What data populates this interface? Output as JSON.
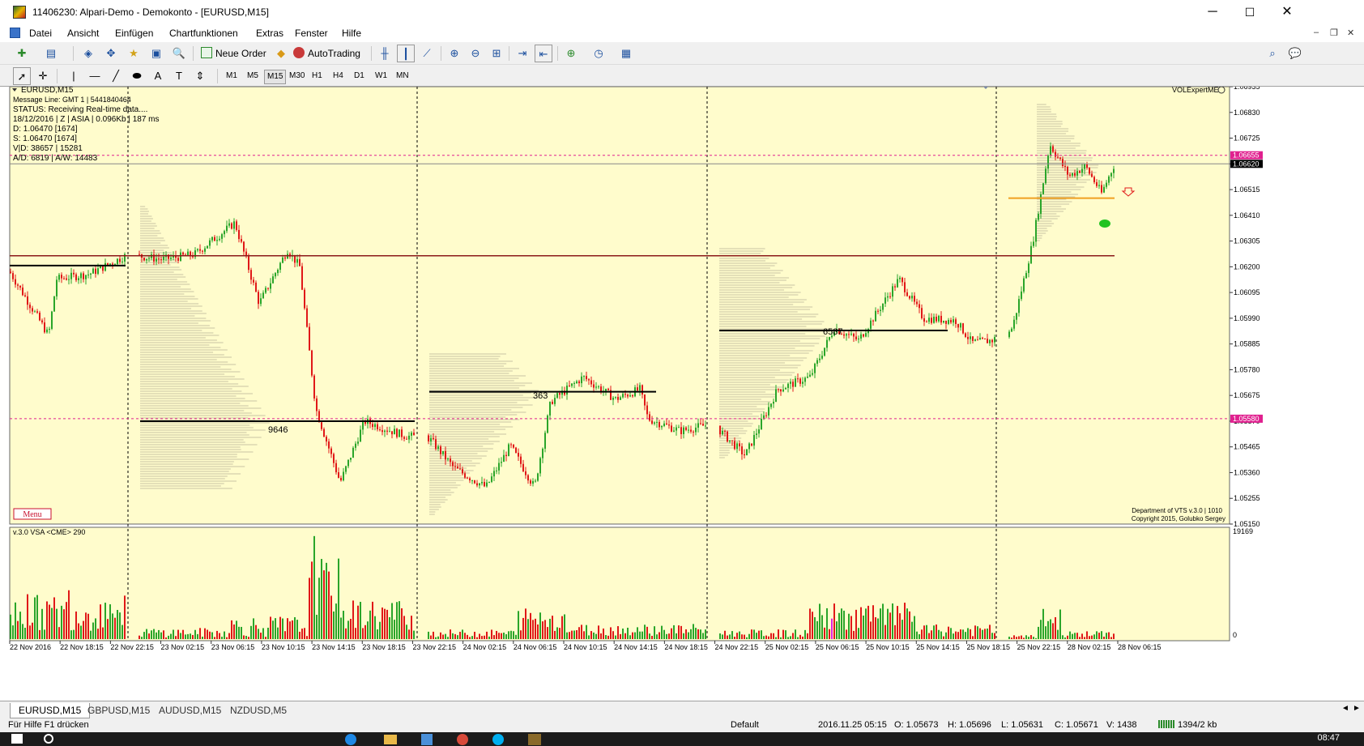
{
  "window": {
    "title": "11406230: Alpari-Demo - Demokonto - [EURUSD,M15]",
    "minimize": "─",
    "maximize": "☐",
    "close": "✕"
  },
  "menu": [
    "Datei",
    "Ansicht",
    "Einfügen",
    "Chartfunktionen",
    "Extras",
    "Fenster",
    "Hilfe"
  ],
  "toolbar": {
    "new_order": "Neue Order",
    "auto_trading": "AutoTrading"
  },
  "timeframes": [
    "M1",
    "M5",
    "M15",
    "M30",
    "H1",
    "H4",
    "D1",
    "W1",
    "MN"
  ],
  "active_timeframe": "M15",
  "chart": {
    "symbol_label": "EURUSD,M15",
    "info_lines": [
      "Message Line: GMT 1 | 5441840464",
      "STATUS:  Receiving Real-time data....",
      "18/12/2016 | Z | ASIA | 0.096Kb | 187 ms",
      "D: 1.06470  [1674]",
      "S: 1.06470  [1674]",
      "V|D: 38657 | 15281",
      "A/D: 6819 | A/W: 14483"
    ],
    "expert_label": "VOLExpertME",
    "menu_button": "Menu",
    "credits_1": "Department of VTS  v.3.0 | 1010",
    "credits_2": "Copyright 2015, Golubko Sergey",
    "volume_labels": [
      "9646",
      "363",
      "6587"
    ],
    "price_ticks": [
      "1.06935",
      "1.06830",
      "1.06725",
      "1.06620",
      "1.06515",
      "1.06410",
      "1.06305",
      "1.06200",
      "1.06095",
      "1.05990",
      "1.05885",
      "1.05780",
      "1.05675",
      "1.05570",
      "1.05465",
      "1.05360",
      "1.05255",
      "1.05150"
    ],
    "price_flags": [
      {
        "text": "1.06655",
        "color": "#e0208f"
      },
      {
        "text": "1.06620",
        "color": "#000000"
      },
      {
        "text": "1.05580",
        "color": "#e0208f"
      }
    ],
    "time_labels": [
      "22 Nov 2016",
      "22 Nov 18:15",
      "22 Nov 22:15",
      "23 Nov 02:15",
      "23 Nov 06:15",
      "23 Nov 10:15",
      "23 Nov 14:15",
      "23 Nov 18:15",
      "23 Nov 22:15",
      "24 Nov 02:15",
      "24 Nov 06:15",
      "24 Nov 10:15",
      "24 Nov 14:15",
      "24 Nov 18:15",
      "24 Nov 22:15",
      "25 Nov 02:15",
      "25 Nov 06:15",
      "25 Nov 10:15",
      "25 Nov 14:15",
      "25 Nov 18:15",
      "25 Nov 22:15",
      "28 Nov 02:15",
      "28 Nov 06:15"
    ],
    "sub_title": "v.3.0  VSA  <CME>  290",
    "sub_max": "19169",
    "sub_min": "0",
    "colors": {
      "background": "#fffccc",
      "bull": "#2aa52a",
      "bear": "#e01818",
      "level": "#8b1a1a",
      "orange": "#f0a020",
      "signal": "#22c322"
    }
  },
  "tabs": [
    "EURUSD,M15",
    "GBPUSD,M15",
    "AUDUSD,M15",
    "NZDUSD,M5"
  ],
  "active_tab": "EURUSD,M15",
  "status": {
    "help": "Für Hilfe F1 drücken",
    "profile": "Default",
    "time": "2016.11.25 05:15",
    "open": "O: 1.05673",
    "high": "H: 1.05696",
    "low": "L: 1.05631",
    "close": "C: 1.05671",
    "volume": "V: 1438",
    "traffic": "1394/2 kb"
  },
  "taskbar": {
    "clock": "08:47"
  }
}
